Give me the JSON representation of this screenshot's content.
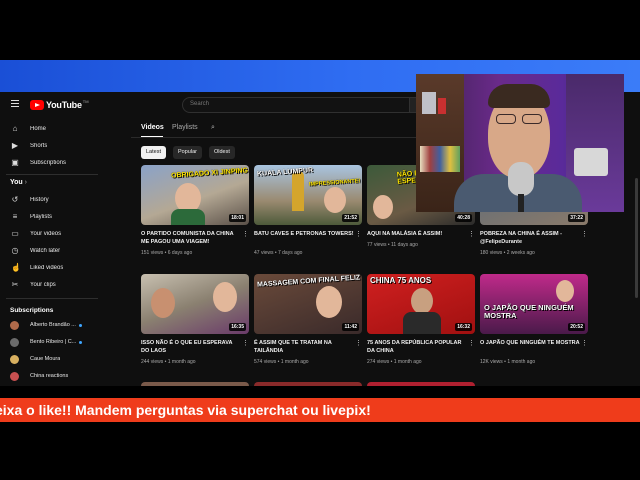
{
  "search": {
    "placeholder": "Search"
  },
  "logo": {
    "text": "YouTube",
    "tm": "TM"
  },
  "sidebar": {
    "items": [
      {
        "label": "Home",
        "icon": "home-icon"
      },
      {
        "label": "Shorts",
        "icon": "shorts-icon"
      },
      {
        "label": "Subscriptions",
        "icon": "subscriptions-icon"
      }
    ],
    "you_heading": "You",
    "you_items": [
      {
        "label": "History",
        "icon": "history-icon"
      },
      {
        "label": "Playlists",
        "icon": "playlists-icon"
      },
      {
        "label": "Your videos",
        "icon": "video-icon"
      },
      {
        "label": "Watch later",
        "icon": "clock-icon"
      },
      {
        "label": "Liked videos",
        "icon": "thumbs-up-icon"
      },
      {
        "label": "Your clips",
        "icon": "scissors-icon"
      }
    ],
    "subs_heading": "Subscriptions",
    "subs": [
      {
        "label": "Alberto Brandão ...",
        "color": "#b06a4a"
      },
      {
        "label": "Bento Ribeiro | C...",
        "color": "#6b6b6b"
      },
      {
        "label": "Caue Moura",
        "color": "#d8b060"
      },
      {
        "label": "China reactions",
        "color": "#c85050"
      }
    ]
  },
  "tabs": [
    "Videos",
    "Playlists"
  ],
  "chips": [
    "Latest",
    "Popular",
    "Oldest"
  ],
  "videos": [
    {
      "title": "O PARTIDO COMUNISTA DA CHINA ME PAGOU UMA VIAGEM!",
      "views": "151 views",
      "age": "6 days ago",
      "duration": "18:01",
      "thumb_text": "OBRIGADO XI JINPING"
    },
    {
      "title": "BATU CAVES E PETRONAS TOWERS!",
      "views": "47 views",
      "age": "7 days ago",
      "duration": "21:52",
      "thumb_text": "KUALA LUMPUR",
      "thumb_text2": "IMPRESSIONANTE!"
    },
    {
      "title": "AQUI NA MALÁSIA É ASSIM!",
      "views": "77 views",
      "age": "11 days ago",
      "duration": "40:28",
      "thumb_text": "NÃO É O QUE EU ESPERAVA"
    },
    {
      "title": "POBREZA NA CHINA É ASSIM - @FelipeDurante",
      "views": "180 views",
      "age": "2 weeks ago",
      "duration": "37:22",
      "thumb_text": ""
    },
    {
      "title": "ISSO NÃO É O QUE EU ESPERAVA DO LAOS",
      "views": "244 views",
      "age": "1 month ago",
      "duration": "16:35",
      "thumb_text": ""
    },
    {
      "title": "É ASSIM QUE TE TRATAM NA TAILÂNDIA",
      "views": "574 views",
      "age": "1 month ago",
      "duration": "11:42",
      "thumb_text": "MASSAGEM COM FINAL FELIZ"
    },
    {
      "title": "75 ANOS DA REPÚBLICA POPULAR DA CHINA",
      "views": "274 views",
      "age": "1 month ago",
      "duration": "16:32",
      "thumb_text": "CHINA 75 ANOS"
    },
    {
      "title": "O JAPÃO QUE NINGUÉM TE MOSTRA",
      "views": "12K views",
      "age": "1 month ago",
      "duration": "20:52",
      "thumb_text": "O JAPÃO QUE NINGUÉM MOSTRA"
    }
  ],
  "ticker": {
    "text": "eixa o like!! Mandem perguntas via superchat ou livepix!"
  },
  "colors": {
    "accent": "#ff0000",
    "ticker": "#ef3c1b",
    "topbar": "#2f6df2"
  }
}
